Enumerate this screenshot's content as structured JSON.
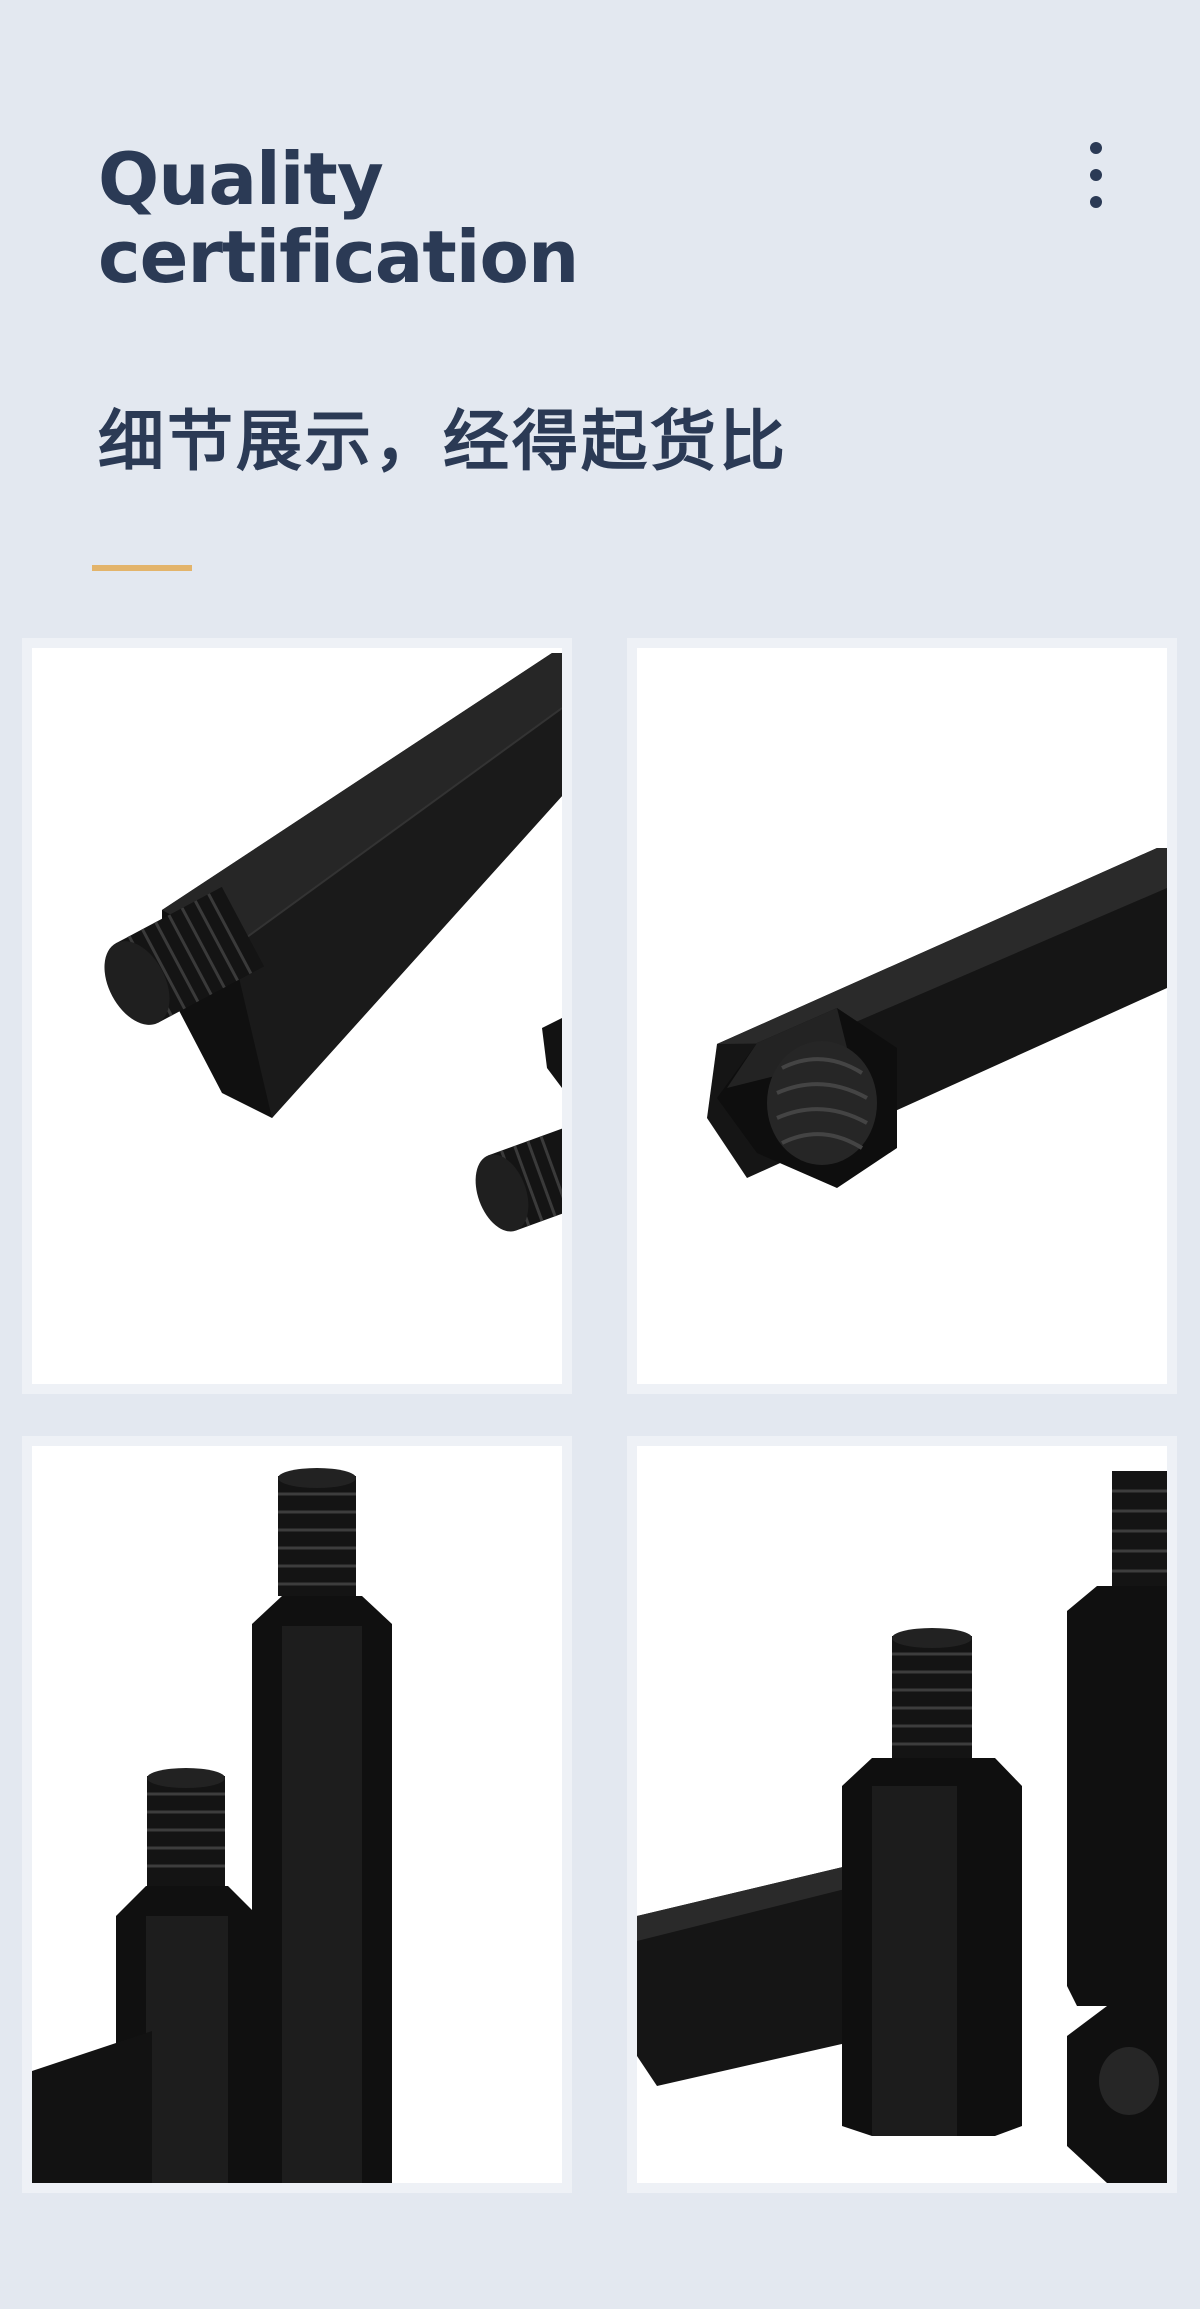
{
  "header": {
    "title_line1": "Quality",
    "title_line2": "certification",
    "subtitle": "细节展示，经得起货比",
    "menu_icon": "more-vertical-icon",
    "accent_color": "#e3b46b",
    "text_color": "#2b3a55"
  },
  "gallery": {
    "images": [
      {
        "subject": "male-thread-hex-standoff-closeup"
      },
      {
        "subject": "female-thread-hex-standoff-closeup"
      },
      {
        "subject": "two-upright-hex-standoffs"
      },
      {
        "subject": "group-of-hex-standoffs"
      }
    ]
  }
}
